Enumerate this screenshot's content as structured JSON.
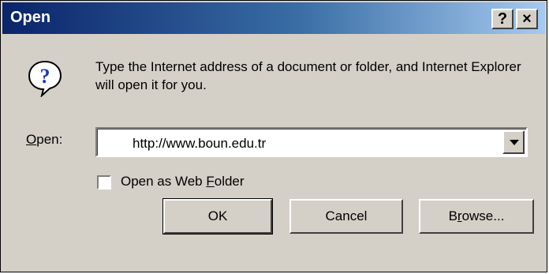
{
  "dialog": {
    "title": "Open",
    "help_button": "?",
    "close_button": "×",
    "prompt": "Type the Internet address of a document or folder, and Internet Explorer will open it for you.",
    "open_label_mnemonic": "O",
    "open_label_rest": "pen:",
    "address_value": "http://www.boun.edu.tr",
    "checkbox_label_pre": "Open as Web ",
    "checkbox_label_mnemonic": "F",
    "checkbox_label_post": "older",
    "checkbox_checked": false,
    "ok_label": "OK",
    "cancel_label": "Cancel",
    "browse_label_pre": "B",
    "browse_label_mnemonic": "r",
    "browse_label_post": "owse..."
  },
  "icons": {
    "question": "question-balloon-icon",
    "dropdown": "dropdown-arrow-icon"
  },
  "colors": {
    "title_start": "#0a246a",
    "title_end": "#a6caf0",
    "face": "#d4d0c8",
    "icon_blue": "#1a3bbd"
  }
}
